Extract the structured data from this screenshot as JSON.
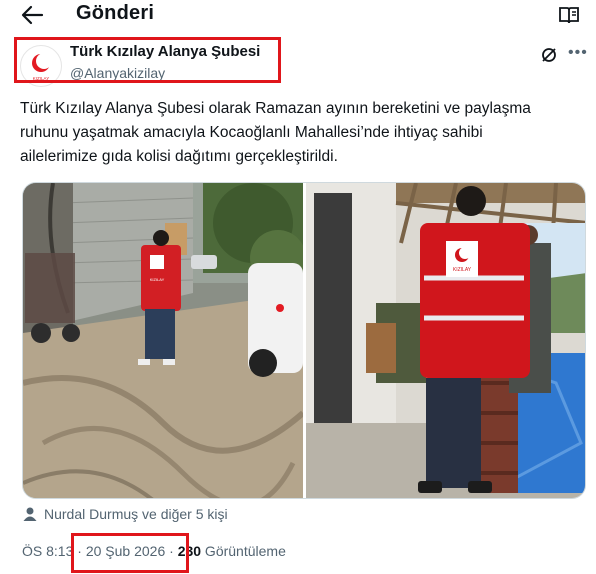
{
  "header": {
    "title": "Gönderi"
  },
  "author": {
    "name": "Türk Kızılay Alanya Şubesi",
    "handle": "@Alanyakizilay",
    "avatar_caption": "KIZILAY"
  },
  "tweet": {
    "lines": [
      "Türk Kızılay Alanya Şubesi olarak Ramazan ayının bereketini ve paylaşma",
      "ruhunu yaşatmak amacıyla Kocaoğlanlı Mahallesi’nde ihtiyaç sahibi",
      "ailelerimize gıda kolisi dağıtımı gerçekleştirildi."
    ]
  },
  "photos": {
    "vest_label": "KIZILAY"
  },
  "mention": "Nurdal Durmuş ve diğer 5 kişi",
  "meta": {
    "time": "ÖS 8:13",
    "sep1": " · ",
    "date": "20 Şub 2026",
    "sep2": " · ",
    "views": "230",
    "views_label": " Görüntüleme"
  },
  "colors": {
    "highlight": "#e0161b",
    "kizilay_red": "#e31b23",
    "muted": "#536471"
  },
  "icons": [
    "back-arrow-icon",
    "reader-icon",
    "grok-icon",
    "more-icon",
    "person-icon"
  ]
}
